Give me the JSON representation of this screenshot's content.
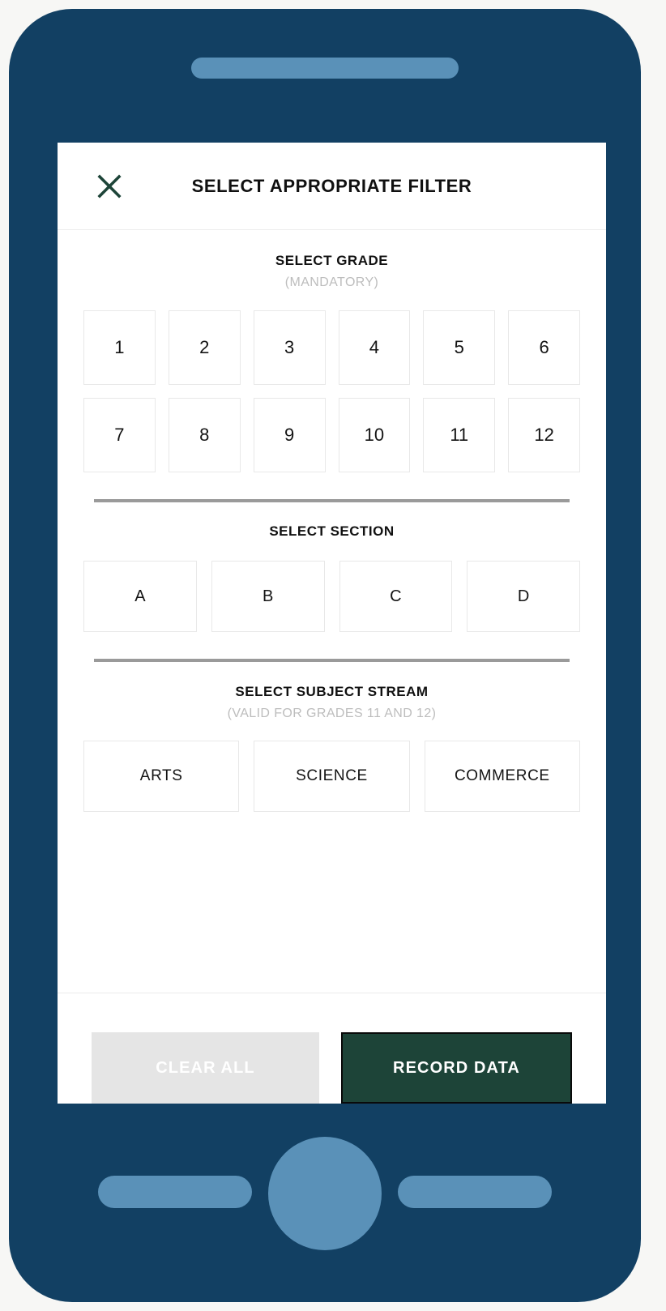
{
  "device": {
    "frame_color": "#124063",
    "accent_color": "#5a91b8"
  },
  "dialog": {
    "title": "SELECT APPROPRIATE FILTER",
    "close_icon": "close-icon"
  },
  "grade": {
    "heading": "SELECT GRADE",
    "subheading": "(MANDATORY)",
    "options": [
      "1",
      "2",
      "3",
      "4",
      "5",
      "6",
      "7",
      "8",
      "9",
      "10",
      "11",
      "12"
    ]
  },
  "section": {
    "heading": "SELECT SECTION",
    "options": [
      "A",
      "B",
      "C",
      "D"
    ]
  },
  "stream": {
    "heading": "SELECT SUBJECT STREAM",
    "subheading": "(VALID FOR GRADES 11 AND 12)",
    "options": [
      "ARTS",
      "SCIENCE",
      "COMMERCE"
    ]
  },
  "footer": {
    "clear_label": "CLEAR ALL",
    "record_label": "RECORD DATA",
    "clear_bg": "#e5e5e5",
    "record_bg": "#1d4438"
  }
}
